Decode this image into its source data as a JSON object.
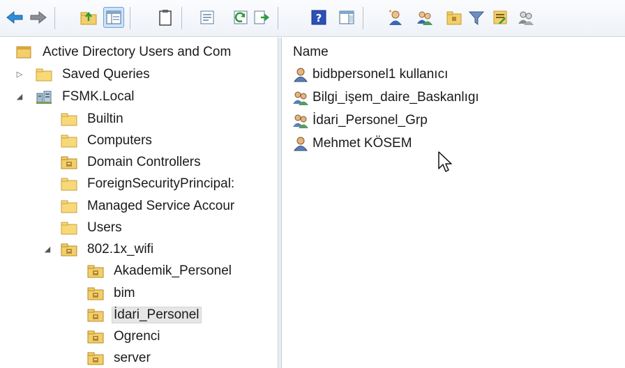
{
  "toolbar": {
    "icons": [
      "back-arrow-icon",
      "forward-arrow-icon",
      "up-folder-icon",
      "show-hide-tree-icon",
      "clipboard-icon",
      "properties-icon",
      "refresh-icon",
      "export-list-icon",
      "help-icon",
      "action-pane-icon",
      "new-user-icon",
      "new-group-icon",
      "new-ou-icon",
      "filter-icon",
      "add-to-group-icon",
      "delegate-control-icon"
    ]
  },
  "tree": {
    "root": "Active Directory Users and Com",
    "saved_queries": "Saved Queries",
    "domain": "FSMK.Local",
    "children": [
      "Builtin",
      "Computers",
      "Domain Controllers",
      "ForeignSecurityPrincipal:",
      "Managed Service Accour",
      "Users"
    ],
    "ou": "802.1x_wifi",
    "ou_children": [
      "Akademik_Personel",
      "bim",
      "İdari_Personel",
      "Ogrenci",
      "server"
    ],
    "selected": "İdari_Personel"
  },
  "list": {
    "column_header": "Name",
    "items": [
      {
        "name": "bidbpersonel1 kullanıcı",
        "type": "user"
      },
      {
        "name": "Bilgi_işem_daire_Baskanlıgı",
        "type": "group"
      },
      {
        "name": "İdari_Personel_Grp",
        "type": "group"
      },
      {
        "name": "Mehmet KÖSEM",
        "type": "user"
      }
    ]
  }
}
